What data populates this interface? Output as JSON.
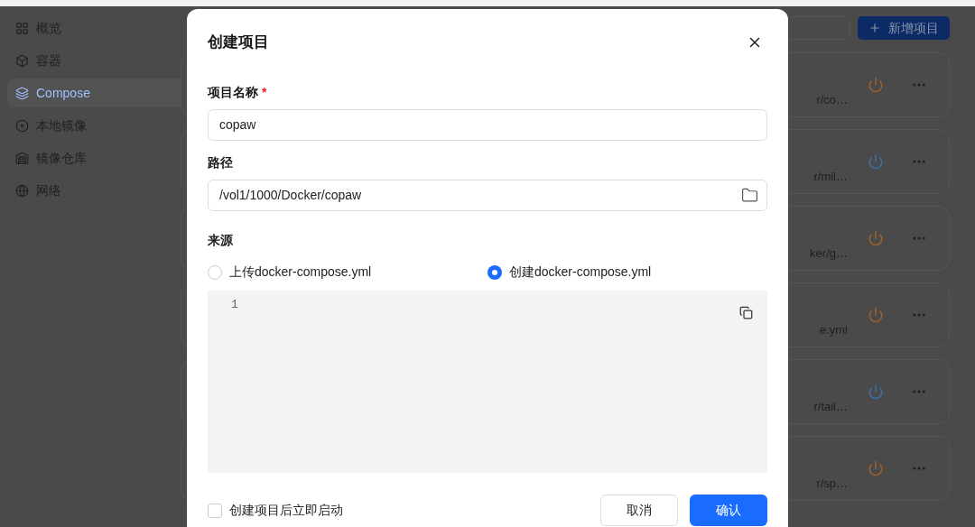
{
  "sidebar": {
    "items": [
      {
        "label": "概览",
        "selected": false
      },
      {
        "label": "容器",
        "selected": false
      },
      {
        "label": "Compose",
        "selected": true
      },
      {
        "label": "本地镜像",
        "selected": false
      },
      {
        "label": "镜像仓库",
        "selected": false
      },
      {
        "label": "网络",
        "selected": false
      }
    ]
  },
  "toolbar": {
    "add_button": "新增项目"
  },
  "projects": [
    {
      "path": "r/co…",
      "color": "#a0612a"
    },
    {
      "path": "r/mil…",
      "color": "#3a72a8"
    },
    {
      "path": "ker/g…",
      "color": "#a0612a"
    },
    {
      "path": "e.yml",
      "color": "#a0612a"
    },
    {
      "path": "r/tail…",
      "color": "#3a72a8"
    },
    {
      "path": "r/sp…",
      "color": "#a0612a"
    }
  ],
  "dialog": {
    "title": "创建项目",
    "fields": [
      {
        "kind": "text",
        "label": "项目名称",
        "required_mark": "*",
        "value": "copaw"
      },
      {
        "kind": "path",
        "label": "路径",
        "value": "/vol1/1000/Docker/copaw"
      }
    ],
    "source": {
      "label": "来源",
      "options": [
        {
          "label": "上传docker-compose.yml",
          "selected": false
        },
        {
          "label": "创建docker-compose.yml",
          "selected": true
        }
      ]
    },
    "editor": {
      "line_numbers": [
        "1"
      ]
    },
    "start_after_create": {
      "label": "创建项目后立即启动",
      "checked": false
    },
    "buttons": [
      {
        "kind": "secondary",
        "label": "取消"
      },
      {
        "kind": "primary",
        "label": "确认"
      }
    ]
  }
}
